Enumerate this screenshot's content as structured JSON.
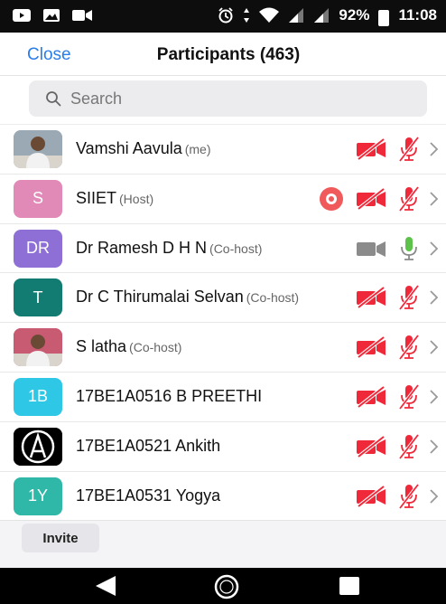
{
  "status_bar": {
    "battery": "92%",
    "time": "11:08",
    "left_icons": [
      "youtube-icon",
      "gallery-icon",
      "video-icon"
    ],
    "right_icons": [
      "alarm-icon",
      "data-arrows-icon",
      "wifi-icon",
      "signal-icon",
      "signal-icon",
      "battery-icon"
    ]
  },
  "header": {
    "close_label": "Close",
    "title": "Participants (463)"
  },
  "search": {
    "placeholder": "Search"
  },
  "participants": [
    {
      "name": "Vamshi Aavula",
      "role": "(me)",
      "avatar_type": "photo",
      "avatar_text": "",
      "avatar_color": "#9aa9b4",
      "camera": "off",
      "mic": "muted",
      "sharing": false
    },
    {
      "name": "SIIET",
      "role": "(Host)",
      "avatar_type": "initials",
      "avatar_text": "S",
      "avatar_color": "#e18ab8",
      "camera": "off",
      "mic": "muted",
      "sharing": true
    },
    {
      "name": "Dr Ramesh D H N",
      "role": "(Co-host)",
      "avatar_type": "initials",
      "avatar_text": "DR",
      "avatar_color": "#8e6fd6",
      "camera": "on",
      "mic": "on",
      "sharing": false
    },
    {
      "name": "Dr C Thirumalai Selvan",
      "role": "(Co-host)",
      "avatar_type": "initials",
      "avatar_text": "T",
      "avatar_color": "#127c72",
      "camera": "off",
      "mic": "muted",
      "sharing": false
    },
    {
      "name": "S latha",
      "role": "(Co-host)",
      "avatar_type": "photo",
      "avatar_text": "",
      "avatar_color": "#c85a72",
      "camera": "off",
      "mic": "muted",
      "sharing": false
    },
    {
      "name": "17BE1A0516 B PREETHI",
      "role": "",
      "avatar_type": "initials",
      "avatar_text": "1B",
      "avatar_color": "#2fc7e6",
      "camera": "off",
      "mic": "muted",
      "sharing": false
    },
    {
      "name": "17BE1A0521 Ankith",
      "role": "",
      "avatar_type": "logo",
      "avatar_text": "",
      "avatar_color": "#000000",
      "camera": "off",
      "mic": "muted",
      "sharing": false
    },
    {
      "name": "17BE1A0531 Yogya",
      "role": "",
      "avatar_type": "initials",
      "avatar_text": "1Y",
      "avatar_color": "#2fb8a8",
      "camera": "off",
      "mic": "muted",
      "sharing": false
    }
  ],
  "footer": {
    "invite_label": "Invite"
  },
  "colors": {
    "accent": "#2b7de9",
    "muted_red": "#f0293a",
    "mic_on_green": "#5cc24a",
    "camera_on_gray": "#8b8b8b"
  }
}
